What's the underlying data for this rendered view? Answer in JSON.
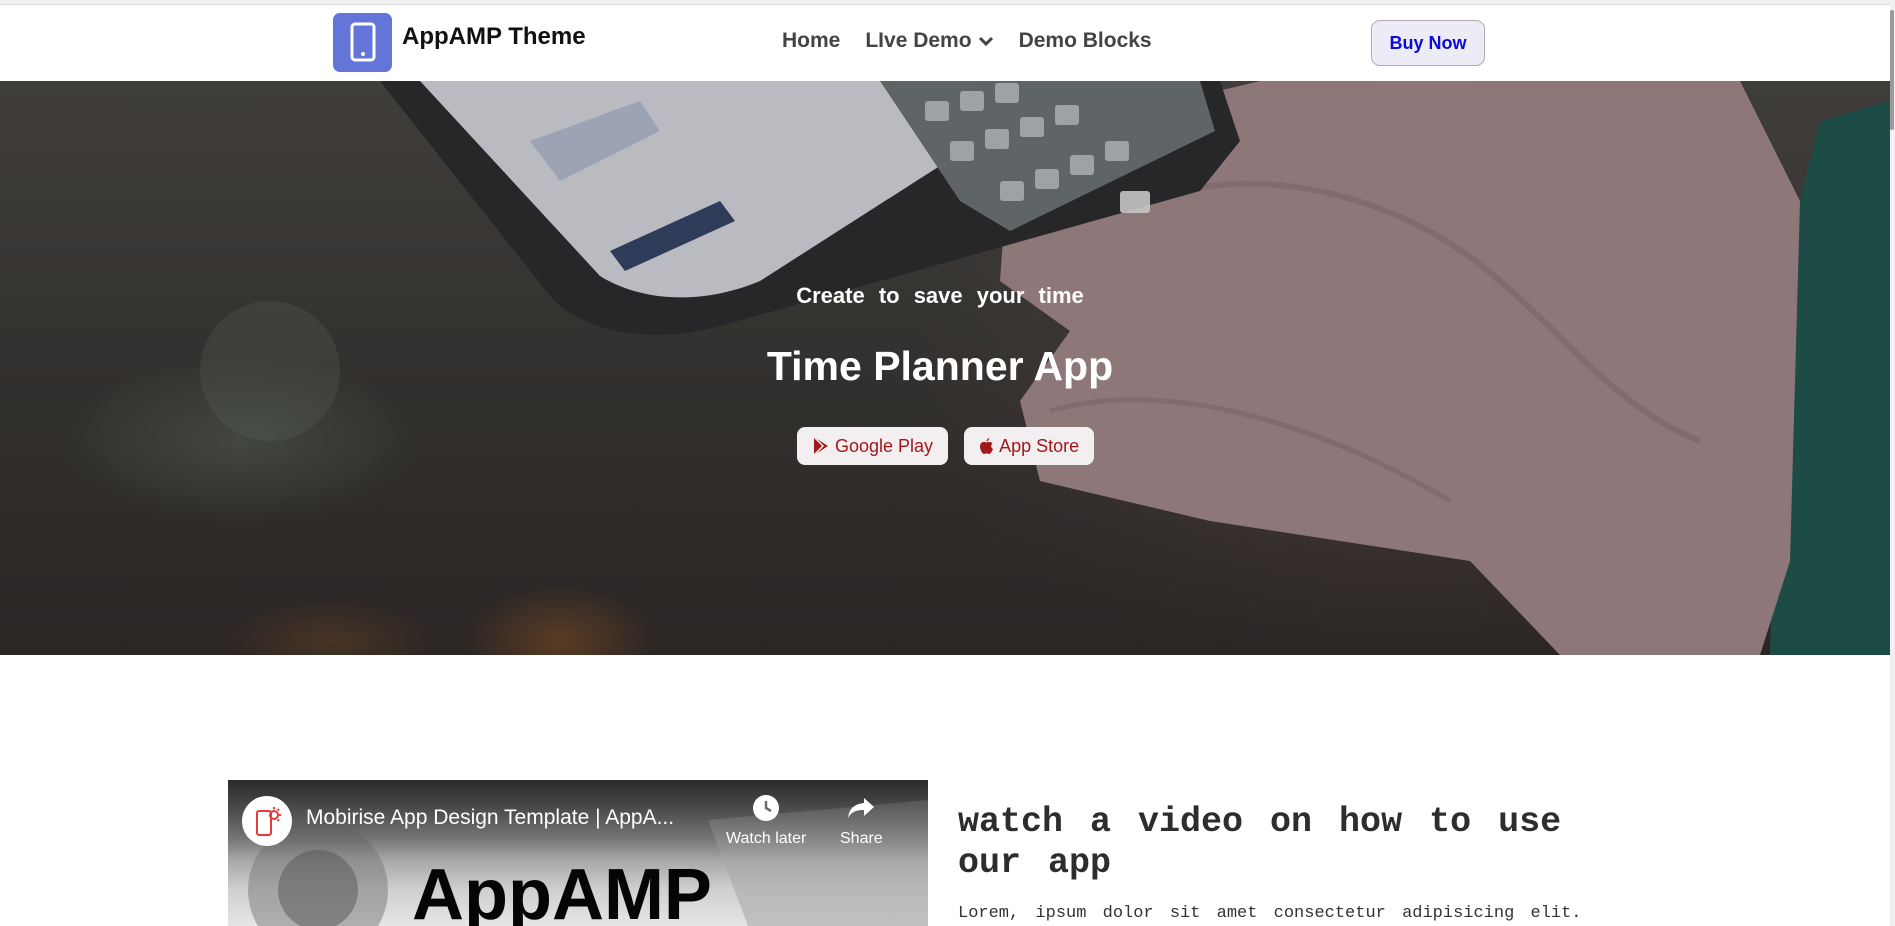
{
  "navbar": {
    "brand_name": "AppAMP Theme",
    "logo_icon": "smartphone-icon",
    "links": [
      {
        "label": "Home"
      },
      {
        "label": "LIve Demo",
        "has_dropdown": true
      },
      {
        "label": "Demo Blocks"
      }
    ],
    "buy_button": "Buy Now"
  },
  "hero": {
    "subtitle": "Create to save your time",
    "title": "Time Planner App",
    "buttons": [
      {
        "label": "Google Play",
        "icon": "play-icon"
      },
      {
        "label": "App Store",
        "icon": "apple-icon"
      }
    ]
  },
  "video": {
    "title": "Mobirise App Design Template | AppA...",
    "watch_later": "Watch later",
    "share": "Share",
    "big_text": "AppAMP"
  },
  "section": {
    "heading": "watch a video on how to use our app",
    "text": "Lorem, ipsum dolor sit amet consectetur adipisicing elit."
  },
  "colors": {
    "brand_logo": "#6475d8",
    "buy_text": "#0b0bd8",
    "store_text": "#a11818"
  }
}
